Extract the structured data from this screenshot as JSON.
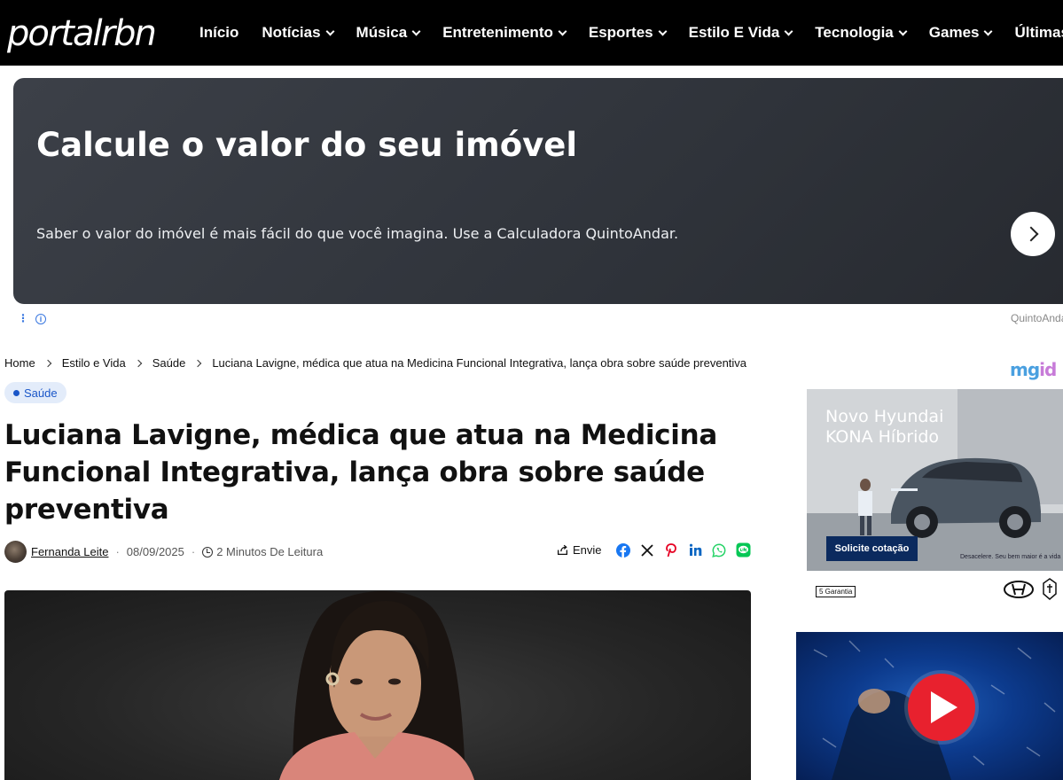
{
  "site": {
    "logo_text": "portalrbn"
  },
  "nav": {
    "items": [
      {
        "label": "Início",
        "has_dropdown": false
      },
      {
        "label": "Notícias",
        "has_dropdown": true
      },
      {
        "label": "Música",
        "has_dropdown": true
      },
      {
        "label": "Entretenimento",
        "has_dropdown": true
      },
      {
        "label": "Esportes",
        "has_dropdown": true
      },
      {
        "label": "Estilo E Vida",
        "has_dropdown": true
      },
      {
        "label": "Tecnologia",
        "has_dropdown": true
      },
      {
        "label": "Games",
        "has_dropdown": true
      },
      {
        "label": "Últimas",
        "has_dropdown": false
      }
    ]
  },
  "ad_banner": {
    "title": "Calcule o valor do seu imóvel",
    "text": "Saber o valor do imóvel é mais fácil do que você imagina. Use a Calculadora QuintoAndar.",
    "advertiser": "QuintoAndar",
    "info_glyph": "i"
  },
  "breadcrumb": {
    "items": [
      "Home",
      "Estilo e Vida",
      "Saúde",
      "Luciana Lavigne, médica que atua na Medicina Funcional Integrativa, lança obra sobre saúde preventiva"
    ]
  },
  "sidebar_brand": {
    "mgid_prefix": "mg",
    "mgid_suffix": "id"
  },
  "article": {
    "category": "Saúde",
    "title": "Luciana Lavigne, médica que atua na Medicina Funcional Integrativa, lança obra sobre saúde preventiva",
    "author": "Fernanda Leite",
    "date": "08/09/2025",
    "reading_time": "2 Minutos De Leitura",
    "share_label": "Envie",
    "share_networks": [
      "facebook-icon",
      "x-icon",
      "pinterest-icon",
      "linkedin-icon",
      "whatsapp-icon",
      "line-icon"
    ]
  },
  "sidebar_ad": {
    "title_line1": "Novo Hyundai",
    "title_line2": "KONA Híbrido",
    "cta": "Solicite cotação",
    "small_text": "Desacelere. Seu bem maior é a vida",
    "garantia": "5 Garantia"
  },
  "colors": {
    "header_bg": "#000000",
    "accent_blue": "#1a56c8",
    "tag_bg": "#e3ecfa",
    "hyundai_cta": "#0b2a5e",
    "play_red": "#e8212e"
  }
}
